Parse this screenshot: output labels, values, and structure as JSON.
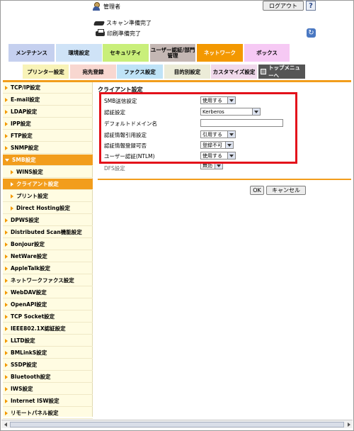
{
  "header": {
    "user_label": "管理者",
    "logout_label": "ログアウト",
    "help_label": "?",
    "status_scan": "スキャン準備完了",
    "status_print": "印刷準備完了"
  },
  "tabs": [
    {
      "label": "メンテナンス",
      "color": "#c5d0ef"
    },
    {
      "label": "環境設定",
      "color": "#cfe3f7"
    },
    {
      "label": "セキュリティ",
      "color": "#c9ef7a"
    },
    {
      "label": "ユーザー認証/部門管理",
      "color": "#c4b7b3"
    },
    {
      "label": "ネットワーク",
      "color": "#f39800"
    },
    {
      "label": "ボックス",
      "color": "#f6c9f4"
    }
  ],
  "subtabs": [
    {
      "label": "プリンター設定",
      "color": "#f8f3b8"
    },
    {
      "label": "宛先登録",
      "color": "#f8d7d0"
    },
    {
      "label": "ファクス設定",
      "color": "#bfe3f7"
    },
    {
      "label": "目的別設定",
      "color": "#ececd8"
    },
    {
      "label": "カスタマイズ設定",
      "color": "#f0d9eb"
    },
    {
      "label": "トップメニューへ",
      "color": "#555555"
    }
  ],
  "sidebar": {
    "items": [
      {
        "label": "TCP/IP設定"
      },
      {
        "label": "E-mail設定"
      },
      {
        "label": "LDAP設定"
      },
      {
        "label": "IPP設定"
      },
      {
        "label": "FTP設定"
      },
      {
        "label": "SNMP設定"
      },
      {
        "label": "SMB設定"
      },
      {
        "label": "WINS設定"
      },
      {
        "label": "クライアント設定"
      },
      {
        "label": "プリント設定"
      },
      {
        "label": "Direct Hosting設定"
      },
      {
        "label": "DPWS設定"
      },
      {
        "label": "Distributed Scan機能設定"
      },
      {
        "label": "Bonjour設定"
      },
      {
        "label": "NetWare設定"
      },
      {
        "label": "AppleTalk設定"
      },
      {
        "label": "ネットワークファクス設定"
      },
      {
        "label": "WebDAV設定"
      },
      {
        "label": "OpenAPI設定"
      },
      {
        "label": "TCP Socket設定"
      },
      {
        "label": "IEEE802.1X認証設定"
      },
      {
        "label": "LLTD設定"
      },
      {
        "label": "BMLinkS設定"
      },
      {
        "label": "SSDP設定"
      },
      {
        "label": "Bluetooth設定"
      },
      {
        "label": "IWS設定"
      },
      {
        "label": "Internet ISW設定"
      },
      {
        "label": "リモートパネル設定"
      }
    ]
  },
  "main": {
    "title": "クライアント設定",
    "rows": [
      {
        "label": "SMB送信設定",
        "value": "使用する"
      },
      {
        "label": "認証設定",
        "value": "Kerberos"
      },
      {
        "label": "デフォルトドメイン名",
        "value": ""
      },
      {
        "label": "認証情報引用設定",
        "value": "引用する"
      },
      {
        "label": "認証情報登録可否",
        "value": "登録不可"
      },
      {
        "label": "ユーザー認証(NTLM)",
        "value": "使用する"
      },
      {
        "label": "DFS設定",
        "value": "無効"
      }
    ],
    "ok_label": "OK",
    "cancel_label": "キャンセル"
  }
}
